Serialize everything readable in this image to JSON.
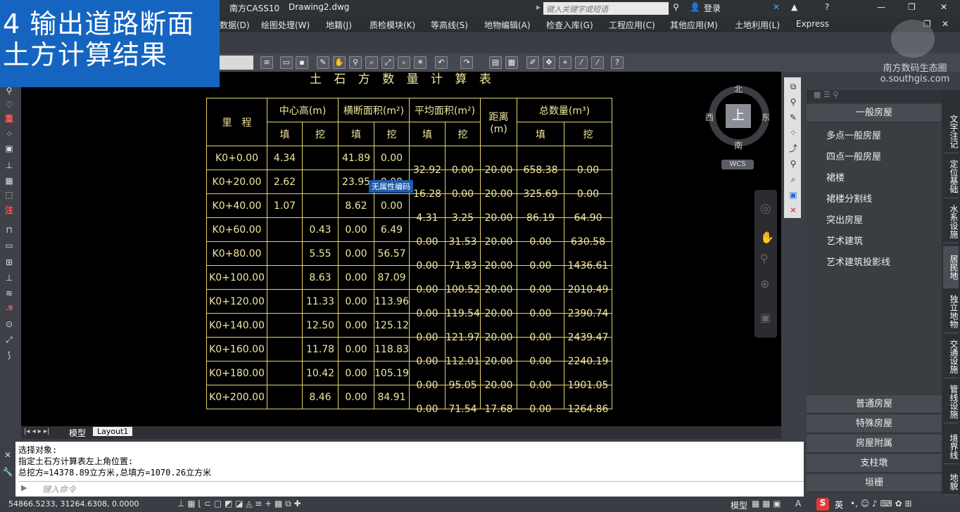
{
  "overlay": {
    "line1": "4 输出道路断面",
    "line2": "土方计算结果"
  },
  "titlebar": {
    "app": "南方CASS10",
    "file": "Drawing2.dwg",
    "search_placeholder": "键入关键字或短语",
    "login": "登录"
  },
  "menu": [
    "数据(D)",
    "绘图处理(W)",
    "地籍(J)",
    "质检模块(K)",
    "等高线(S)",
    "地物编辑(A)",
    "检查入库(G)",
    "工程应用(C)",
    "其他应用(M)",
    "土地利用(L)",
    "Express"
  ],
  "left_tools": [
    "重",
    "注",
    ".9"
  ],
  "table": {
    "title": "土 石 方 数 量 计 算 表",
    "h_station": "里　程",
    "h_center": "中心高(m)",
    "h_area": "横断面积(m²)",
    "h_avg": "平均面积(m²)",
    "h_dist": "距离",
    "h_dist_unit": "(m)",
    "h_total": "总数量(m³)",
    "fill": "填",
    "cut": "挖",
    "rows": [
      [
        "K0+0.00",
        "4.34",
        "",
        "41.89",
        "0.00"
      ],
      [
        "K0+20.00",
        "2.62",
        "",
        "23.95",
        "0.00"
      ],
      [
        "K0+40.00",
        "1.07",
        "",
        "8.62",
        "0.00"
      ],
      [
        "K0+60.00",
        "",
        "0.43",
        "0.00",
        "6.49"
      ],
      [
        "K0+80.00",
        "",
        "5.55",
        "0.00",
        "56.57"
      ],
      [
        "K0+100.00",
        "",
        "8.63",
        "0.00",
        "87.09"
      ],
      [
        "K0+120.00",
        "",
        "11.33",
        "0.00",
        "113.96"
      ],
      [
        "K0+140.00",
        "",
        "12.50",
        "0.00",
        "125.12"
      ],
      [
        "K0+160.00",
        "",
        "11.78",
        "0.00",
        "118.83"
      ],
      [
        "K0+180.00",
        "",
        "10.42",
        "0.00",
        "105.19"
      ],
      [
        "K0+200.00",
        "",
        "8.46",
        "0.00",
        "84.91"
      ]
    ],
    "seg": [
      [
        "32.92",
        "0.00",
        "20.00",
        "658.38",
        "0.00"
      ],
      [
        "16.28",
        "0.00",
        "20.00",
        "325.69",
        "0.00"
      ],
      [
        "4.31",
        "3.25",
        "20.00",
        "86.19",
        "64.90"
      ],
      [
        "0.00",
        "31.53",
        "20.00",
        "0.00",
        "630.58"
      ],
      [
        "0.00",
        "71.83",
        "20.00",
        "0.00",
        "1436.61"
      ],
      [
        "0.00",
        "100.52",
        "20.00",
        "0.00",
        "2010.49"
      ],
      [
        "0.00",
        "119.54",
        "20.00",
        "0.00",
        "2390.74"
      ],
      [
        "0.00",
        "121.97",
        "20.00",
        "0.00",
        "2439.47"
      ],
      [
        "0.00",
        "112.01",
        "20.00",
        "0.00",
        "2240.19"
      ],
      [
        "0.00",
        "95.05",
        "20.00",
        "0.00",
        "1901.05"
      ],
      [
        "0.00",
        "71.54",
        "17.68",
        "0.00",
        "1264.86"
      ]
    ]
  },
  "tooltip": "无属性编码",
  "compass": {
    "n": "北",
    "s": "南",
    "e": "东",
    "w": "西",
    "center": "上",
    "wcs": "WCS"
  },
  "tabs": {
    "model": "模型",
    "layout": "Layout1"
  },
  "cmd": {
    "l1": "选择对象:",
    "l2": "指定土石方计算表左上角位置:",
    "l3": "总挖方=14378.89立方米,总填方=1070.26立方米",
    "placeholder": "键入命令"
  },
  "status": {
    "coords": "54866.5233, 31264.6308, 0.0000",
    "mode": "模型",
    "ime": "英"
  },
  "panel": {
    "header": "一般房屋",
    "items": [
      "多点一般房屋",
      "四点一般房屋",
      "裙楼",
      "裙楼分割线",
      "突出房屋",
      "艺术建筑",
      "艺术建筑投影线"
    ],
    "footer": [
      "普通房屋",
      "特殊房屋",
      "房屋附属",
      "支柱墩",
      "垣栅"
    ],
    "vtabs": [
      "文字注记",
      "定位基础",
      "水系设施",
      "居民地",
      "独立地物",
      "交通设施",
      "管线设施",
      "境界线",
      "地貌"
    ]
  },
  "watermark": {
    "name": "南方数码生态圈",
    "url": "o.southgis.com"
  }
}
